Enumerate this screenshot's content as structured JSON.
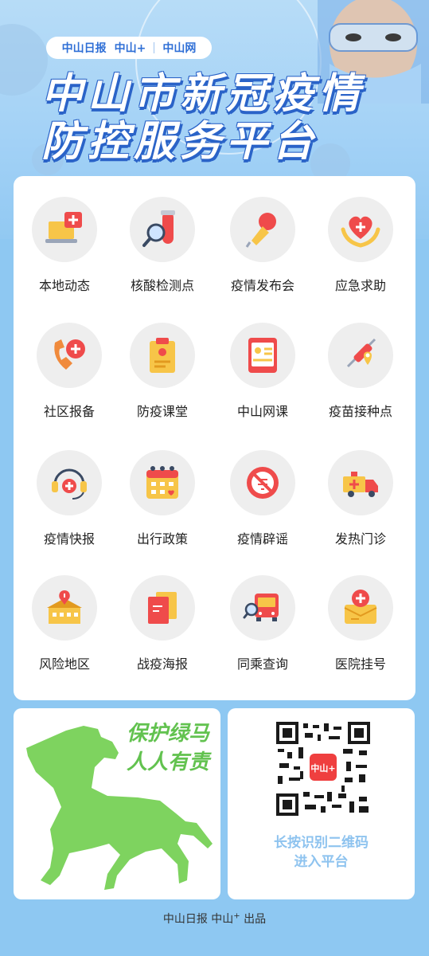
{
  "header": {
    "logos": [
      "中山日报",
      "中山+",
      "中山网"
    ],
    "title_line1": "中山市新冠疫情",
    "title_line2": "防控服务平台"
  },
  "services": [
    {
      "label": "本地动态",
      "icon": "laptop-news-icon"
    },
    {
      "label": "核酸检测点",
      "icon": "test-tube-magnifier-icon"
    },
    {
      "label": "疫情发布会",
      "icon": "microphone-icon"
    },
    {
      "label": "应急求助",
      "icon": "heart-hands-icon"
    },
    {
      "label": "社区报备",
      "icon": "phone-medical-icon"
    },
    {
      "label": "防疫课堂",
      "icon": "clipboard-icon"
    },
    {
      "label": "中山网课",
      "icon": "online-class-icon"
    },
    {
      "label": "疫苗接种点",
      "icon": "syringe-location-icon"
    },
    {
      "label": "疫情快报",
      "icon": "headset-icon"
    },
    {
      "label": "出行政策",
      "icon": "calendar-icon"
    },
    {
      "label": "疫情辟谣",
      "icon": "no-rumor-icon"
    },
    {
      "label": "发热门诊",
      "icon": "ambulance-icon"
    },
    {
      "label": "风险地区",
      "icon": "risk-building-icon"
    },
    {
      "label": "战疫海报",
      "icon": "poster-icon"
    },
    {
      "label": "同乘查询",
      "icon": "bus-search-icon"
    },
    {
      "label": "医院挂号",
      "icon": "hospital-card-icon"
    }
  ],
  "green_horse": {
    "line1": "保护绿马",
    "line2": "人人有责"
  },
  "qr": {
    "line1": "长按识别二维码",
    "line2": "进入平台",
    "center_label": "中山+"
  },
  "footer": {
    "text": "中山日报 中山",
    "plus": "+",
    "suffix": " 出品"
  },
  "colors": {
    "brand_blue": "#2a63c8",
    "accent_red": "#ef4b4b",
    "accent_yellow": "#f7c548",
    "horse_green": "#7ed35f",
    "card_bg": "#ffffff",
    "page_bg": "#8ec8f2"
  }
}
